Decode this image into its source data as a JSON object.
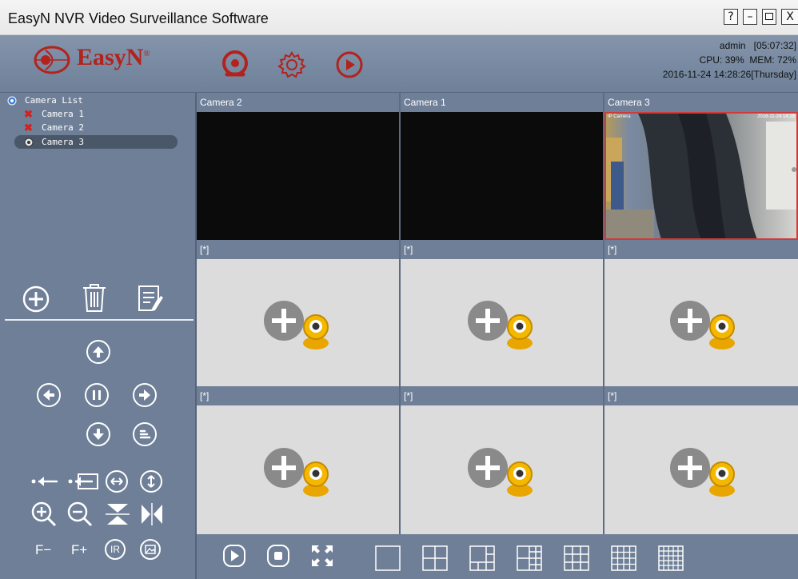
{
  "window": {
    "title": "EasyN NVR Video Surveillance Software",
    "help_label": "?",
    "minimize_label": "–",
    "close_label": "X"
  },
  "header": {
    "brand": "EasyN",
    "trademark": "®",
    "user": "admin",
    "uptime": "[05:07:32]",
    "cpu": "CPU: 39%",
    "mem": "MEM: 72%",
    "datetime": "2016-11-24 14:28:26[Thursday]"
  },
  "camera_tree": {
    "root": "Camera List",
    "items": [
      "Camera 1",
      "Camera 2",
      "Camera 3"
    ]
  },
  "ptz": {
    "focus_minus": "F−",
    "focus_plus": "F+",
    "ir": "IR"
  },
  "grid": {
    "cells": [
      {
        "label": "Camera 2"
      },
      {
        "label": "Camera 1"
      },
      {
        "label": "Camera 3"
      },
      {
        "label": "[*]"
      },
      {
        "label": "[*]"
      },
      {
        "label": "[*]"
      },
      {
        "label": "[*]"
      },
      {
        "label": "[*]"
      },
      {
        "label": "[*]"
      }
    ],
    "overlay_left": "IP Camera",
    "overlay_right": "2016-11-24 14:28"
  },
  "colors": {
    "brand_red": "#b3221c",
    "panel": "#6e7f97",
    "selected_border": "#d23a3a"
  }
}
